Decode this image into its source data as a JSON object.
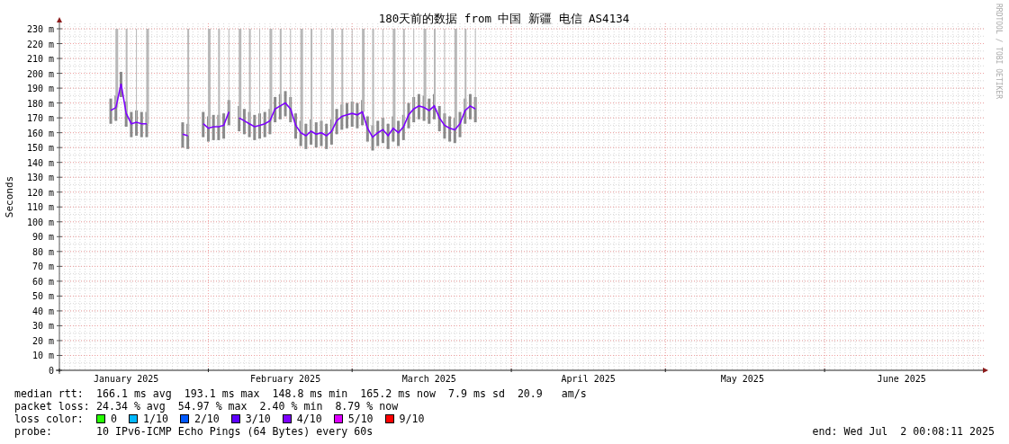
{
  "graph": {
    "credit": "RRDTOOL / TOBI OETIKER",
    "chart_data": {
      "type": "line",
      "title": "180天前的数据 from 中国 新疆 电信 AS4134",
      "ylabel": "Seconds",
      "categories": [
        null,
        null,
        null,
        null,
        null,
        null,
        null,
        null,
        null,
        null,
        null,
        null,
        null,
        "January 2025",
        null,
        null,
        null,
        null,
        null,
        null,
        null,
        null,
        null,
        null,
        null,
        null,
        null,
        null,
        null,
        null,
        null,
        null,
        null,
        null,
        null,
        null,
        null,
        null,
        null,
        null,
        null,
        null,
        null,
        null,
        "February 2025",
        null,
        null,
        null,
        null,
        null,
        null,
        null,
        null,
        null,
        null,
        null,
        null,
        null,
        null,
        null,
        null,
        null,
        null,
        null,
        null,
        null,
        null,
        null,
        null,
        null,
        null,
        null,
        "March 2025",
        null,
        null,
        null,
        null,
        null,
        null,
        null,
        null,
        null,
        null,
        null,
        null,
        null,
        null,
        null,
        null,
        null,
        null,
        null,
        null,
        null,
        null,
        null,
        null,
        null,
        null,
        null,
        null,
        null,
        null,
        "April 2025",
        null,
        null,
        null,
        null,
        null,
        null,
        null,
        null,
        null,
        null,
        null,
        null,
        null,
        null,
        null,
        null,
        null,
        null,
        null,
        null,
        null,
        null,
        null,
        null,
        null,
        null,
        null,
        null,
        null,
        "May 2025",
        null,
        null,
        null,
        null,
        null,
        null,
        null,
        null,
        null,
        null,
        null,
        null,
        null,
        null,
        null,
        null,
        null,
        null,
        null,
        null,
        null,
        null,
        null,
        null,
        null,
        null,
        null,
        null,
        null,
        null,
        "June 2025",
        null,
        null,
        null,
        null,
        null,
        null,
        null,
        null,
        null,
        null,
        null,
        null,
        null,
        null,
        null,
        null
      ],
      "series": [
        {
          "color": "#7e00ff",
          "values": [
            null,
            null,
            null,
            null,
            null,
            null,
            null,
            null,
            null,
            null,
            175,
            177,
            193,
            173,
            166,
            167,
            166,
            166,
            null,
            null,
            null,
            null,
            null,
            null,
            159,
            158,
            null,
            null,
            166,
            163,
            164,
            164,
            165,
            174,
            null,
            170,
            168,
            166,
            164,
            165,
            166,
            168,
            176,
            178,
            180,
            176,
            165,
            160,
            158,
            161,
            159,
            160,
            158,
            161,
            168,
            171,
            172,
            173,
            172,
            174,
            163,
            157,
            160,
            162,
            158,
            163,
            160,
            164,
            172,
            176,
            178,
            177,
            175,
            178,
            170,
            165,
            163,
            162,
            166,
            175,
            178,
            176,
            null,
            null,
            null,
            null,
            null,
            null,
            null,
            null,
            null,
            null,
            null,
            null,
            null,
            null,
            null,
            null,
            null,
            null,
            null,
            null,
            null,
            null,
            null,
            null,
            null,
            null,
            null,
            null,
            null,
            null,
            null,
            null,
            null,
            null,
            null,
            null,
            null,
            null,
            null,
            null,
            null,
            null,
            null,
            null,
            null,
            null,
            null,
            null,
            null,
            null,
            null,
            null,
            null,
            null,
            null,
            null,
            null,
            null,
            null,
            null,
            null,
            null,
            null,
            null,
            null,
            null,
            null,
            null,
            null,
            null,
            null,
            null,
            null,
            null,
            null,
            null,
            null,
            null,
            null,
            null,
            null,
            null,
            null,
            null,
            null,
            null,
            null,
            null,
            null,
            null,
            null,
            null,
            null,
            null,
            null,
            null,
            null,
            null,
            null
          ]
        }
      ],
      "ylim": [
        0,
        230
      ],
      "grid": true,
      "yticks": [
        {
          "value": 0,
          "label": "0"
        },
        {
          "value": 10,
          "label": "10 m"
        },
        {
          "value": 20,
          "label": "20 m"
        },
        {
          "value": 30,
          "label": "30 m"
        },
        {
          "value": 40,
          "label": "40 m"
        },
        {
          "value": 50,
          "label": "50 m"
        },
        {
          "value": 60,
          "label": "60 m"
        },
        {
          "value": 70,
          "label": "70 m"
        },
        {
          "value": 80,
          "label": "80 m"
        },
        {
          "value": 90,
          "label": "90 m"
        },
        {
          "value": 100,
          "label": "100 m"
        },
        {
          "value": 110,
          "label": "110 m"
        },
        {
          "value": 120,
          "label": "120 m"
        },
        {
          "value": 130,
          "label": "130 m"
        },
        {
          "value": 140,
          "label": "140 m"
        },
        {
          "value": 150,
          "label": "150 m"
        },
        {
          "value": 160,
          "label": "160 m"
        },
        {
          "value": 170,
          "label": "170 m"
        },
        {
          "value": 180,
          "label": "180 m"
        },
        {
          "value": 190,
          "label": "190 m"
        },
        {
          "value": 200,
          "label": "200 m"
        },
        {
          "value": 210,
          "label": "210 m"
        },
        {
          "value": 220,
          "label": "220 m"
        },
        {
          "value": 230,
          "label": "230 m"
        }
      ]
    }
  },
  "stats": [
    {
      "label": "median rtt:",
      "values": [
        "166.1 ms avg",
        "193.1 ms max",
        "148.8 ms min",
        "165.2 ms now",
        "7.9 ms sd",
        "20.9   am/s"
      ]
    },
    {
      "label": "packet loss:",
      "values": [
        "24.34 % avg",
        "54.97 % max",
        "2.40 % min",
        "8.79 % now"
      ]
    }
  ],
  "loss_colors": {
    "label": "loss color:",
    "items": [
      {
        "label": "0",
        "color": "#26ff00"
      },
      {
        "label": "1/10",
        "color": "#00b8ff"
      },
      {
        "label": "2/10",
        "color": "#0059ff"
      },
      {
        "label": "3/10",
        "color": "#5e00ff"
      },
      {
        "label": "4/10",
        "color": "#7e00ff"
      },
      {
        "label": "5/10",
        "color": "#dd00ff"
      },
      {
        "label": "9/10",
        "color": "#ff0000"
      }
    ]
  },
  "probe": {
    "label": "probe:",
    "value": "10 IPv6-ICMP Echo Pings (64 Bytes) every 60s",
    "end": "end: Wed Jul  2 00:08:11 2025"
  }
}
